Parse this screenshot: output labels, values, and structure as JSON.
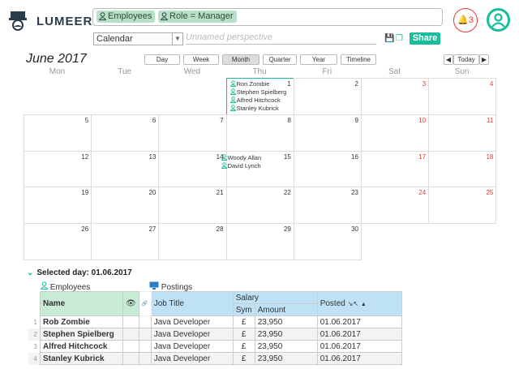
{
  "app": {
    "name": "LUMEER",
    "notifications": "3"
  },
  "search": {
    "chips": [
      {
        "icon": "user-icon",
        "label": "Employees"
      },
      {
        "icon": "user-icon",
        "label": "Role = Manager"
      }
    ]
  },
  "perspective": {
    "view_type": "Calendar",
    "name_placeholder": "Unnamed perspective",
    "share_label": "Share"
  },
  "calendar": {
    "title": "June 2017",
    "views": [
      "Day",
      "Week",
      "Month",
      "Quarter",
      "Year",
      "Timeline"
    ],
    "active_view": "Month",
    "today_label": "Today",
    "prev": "◀",
    "next": "▶",
    "weekdays": [
      "Mon",
      "Tue",
      "Wed",
      "Thu",
      "Fri",
      "Sat",
      "Sun"
    ],
    "weeks": [
      [
        "",
        "",
        "",
        "1",
        "2",
        "3",
        "4"
      ],
      [
        "5",
        "6",
        "7",
        "8",
        "9",
        "10",
        "11"
      ],
      [
        "12",
        "13",
        "14",
        "15",
        "16",
        "17",
        "18"
      ],
      [
        "19",
        "20",
        "21",
        "22",
        "23",
        "24",
        "25"
      ],
      [
        "26",
        "27",
        "28",
        "29",
        "30",
        "",
        ""
      ]
    ],
    "events_jun1": [
      "Ron Zombie",
      "Stephen Spielberg",
      "Alfred Hitchcock",
      "Stanley Kubrick"
    ],
    "events_jun15": [
      "Woody Allan",
      "David Lynch"
    ]
  },
  "selected": {
    "label": "Selected day: 01.06.2017",
    "collections": [
      "Employees",
      "Postings"
    ],
    "headers": {
      "name": "Name",
      "job_title": "Job Title",
      "salary": "Salary",
      "sym": "Sym",
      "amount": "Amount",
      "posted": "Posted"
    },
    "rows": [
      {
        "no": "1",
        "name": "Rob Zombie",
        "job": "Java Developer",
        "sym": "£",
        "amount": "23,950",
        "posted": "01.06.2017"
      },
      {
        "no": "2",
        "name": "Stephen Spielberg",
        "job": "Java Developer",
        "sym": "£",
        "amount": "23,950",
        "posted": "01.06.2017"
      },
      {
        "no": "3",
        "name": "Alfred Hitchcock",
        "job": "Java Developer",
        "sym": "£",
        "amount": "23,950",
        "posted": "01.06.2017"
      },
      {
        "no": "4",
        "name": "Stanley Kubrick",
        "job": "Java Developer",
        "sym": "£",
        "amount": "23,950",
        "posted": "01.06.2017"
      }
    ]
  },
  "colors": {
    "accent": "#1abc9c",
    "weekend": "#e53935",
    "green_header": "#c8ebd6",
    "blue_header": "#bfe1f6"
  }
}
